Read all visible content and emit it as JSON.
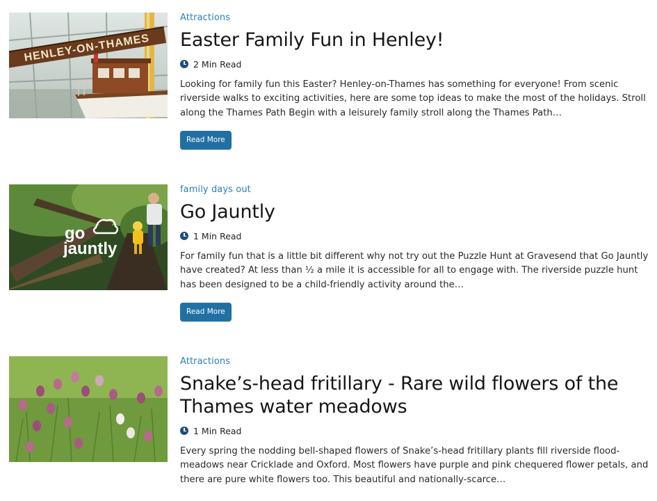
{
  "articles": [
    {
      "category": "Attractions",
      "title": "Easter Family Fun in Henley!",
      "read_time": "2 Min Read",
      "excerpt": "Looking for family fun this Easter? Henley-on-Thames has something for everyone! From scenic riverside walks to exciting activities, here are some top ideas to make the most of the holidays. Stroll along the Thames Path Begin with a leisurely family stroll along the Thames Path…",
      "button": "Read More",
      "image_sign_text": "HENLEY-ON-THAMES"
    },
    {
      "category": "family days out",
      "title": "Go Jauntly",
      "read_time": "1 Min Read",
      "excerpt": "For family fun that is a little bit different why not try out the Puzzle Hunt at Gravesend that Go Jauntly have created? At less than ½ a mile it is accessible for all to engage with. The riverside puzzle hunt has been designed to be a child-friendly activity around the…",
      "button": "Read More",
      "image_logo_text_1": "go",
      "image_logo_text_2": "jauntly"
    },
    {
      "category": "Attractions",
      "title": "Snake’s-head fritillary - Rare wild flowers of the Thames water meadows",
      "read_time": "1 Min Read",
      "excerpt": "Every spring the nodding bell-shaped flowers of Snake’s-head fritillary plants fill riverside flood-meadows near Cricklade and Oxford. Most flowers have purple and pink chequered flower petals, and there are pure white flowers too. This beautiful and nationally-scarce…"
    }
  ],
  "colors": {
    "accent": "#2a7fb8",
    "button": "#2170a4",
    "clock_icon": "#1f4e7a"
  }
}
